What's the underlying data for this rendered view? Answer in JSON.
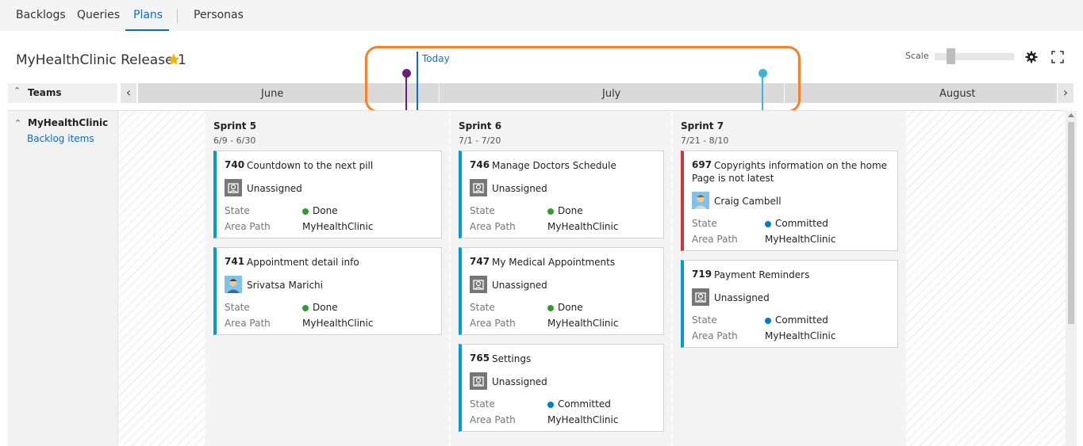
{
  "nav": {
    "tabs": [
      {
        "label": "Backlogs"
      },
      {
        "label": "Queries"
      },
      {
        "label": "Plans"
      },
      {
        "label": "Personas"
      }
    ]
  },
  "plan": {
    "title": "MyHealthClinic Release 1"
  },
  "toolbar": {
    "scale_label": "Scale"
  },
  "timeline": {
    "teams_label": "Teams",
    "months": [
      "June",
      "July",
      "August"
    ],
    "today_label": "Today",
    "colors": {
      "today": "#106ebe",
      "marker_purple": "#68217a",
      "marker_teal": "#3fb3d8",
      "highlight": "#f08230"
    }
  },
  "team": {
    "name": "MyHealthClinic",
    "backlog_link": "Backlog items"
  },
  "sprints": [
    {
      "name": "Sprint 5",
      "dates": "6/9 - 6/30",
      "cards": [
        {
          "id": "740",
          "title": "Countdown to the next pill",
          "assignee": "Unassigned",
          "state_label": "State",
          "state": "Done",
          "area_label": "Area Path",
          "area": "MyHealthClinic"
        },
        {
          "id": "741",
          "title": "Appointment detail info",
          "assignee": "Srivatsa Marichi",
          "state_label": "State",
          "state": "Done",
          "area_label": "Area Path",
          "area": "MyHealthClinic"
        }
      ]
    },
    {
      "name": "Sprint 6",
      "dates": "7/1 - 7/20",
      "cards": [
        {
          "id": "746",
          "title": "Manage Doctors Schedule",
          "assignee": "Unassigned",
          "state_label": "State",
          "state": "Done",
          "area_label": "Area Path",
          "area": "MyHealthClinic"
        },
        {
          "id": "747",
          "title": "My Medical Appointments",
          "assignee": "Unassigned",
          "state_label": "State",
          "state": "Done",
          "area_label": "Area Path",
          "area": "MyHealthClinic"
        },
        {
          "id": "765",
          "title": "Settings",
          "assignee": "Unassigned",
          "state_label": "State",
          "state": "Committed",
          "area_label": "Area Path",
          "area": "MyHealthClinic"
        }
      ]
    },
    {
      "name": "Sprint 7",
      "dates": "7/21 - 8/10",
      "cards": [
        {
          "id": "697",
          "title": "Copyrights information on the home",
          "title_line2": "Page is not latest",
          "assignee": "Craig Cambell",
          "state_label": "State",
          "state": "Committed",
          "area_label": "Area Path",
          "area": "MyHealthClinic"
        },
        {
          "id": "719",
          "title": "Payment Reminders",
          "assignee": "Unassigned",
          "state_label": "State",
          "state": "Committed",
          "area_label": "Area Path",
          "area": "MyHealthClinic"
        }
      ]
    }
  ],
  "state_colors": {
    "Done": "#339933",
    "Committed": "#007acc"
  },
  "card_colors": {
    "default": "#009ccc",
    "bug": "#d13438"
  }
}
